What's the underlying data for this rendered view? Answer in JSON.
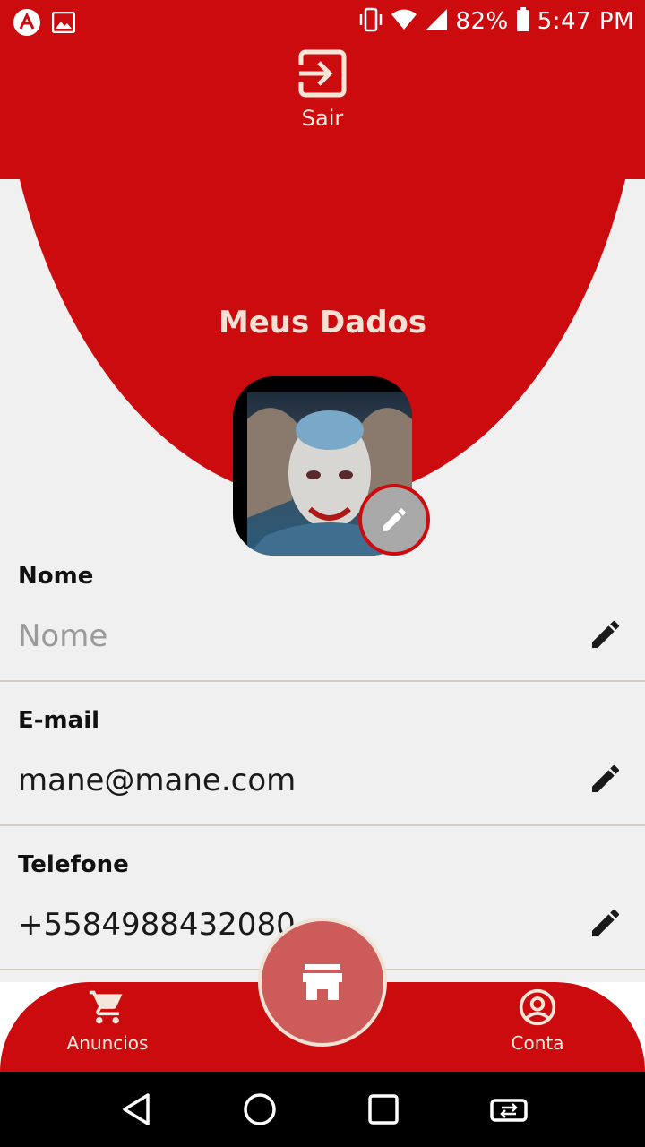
{
  "status_bar": {
    "battery": "82%",
    "time": "5:47 PM"
  },
  "header": {
    "logout_label": "Sair",
    "title": "Meus Dados"
  },
  "fields": [
    {
      "label": "Nome",
      "value": "Nome",
      "is_placeholder": true
    },
    {
      "label": "E-mail",
      "value": "mane@mane.com",
      "is_placeholder": false
    },
    {
      "label": "Telefone",
      "value": "+5584988432080",
      "is_placeholder": false
    }
  ],
  "bottom_nav": {
    "left_label": "Anuncios",
    "right_label": "Conta",
    "center_icon": "store-icon"
  },
  "colors": {
    "brand": "#cc0b0e",
    "fab": "#cd5b59",
    "text_light": "#f5e6da"
  }
}
